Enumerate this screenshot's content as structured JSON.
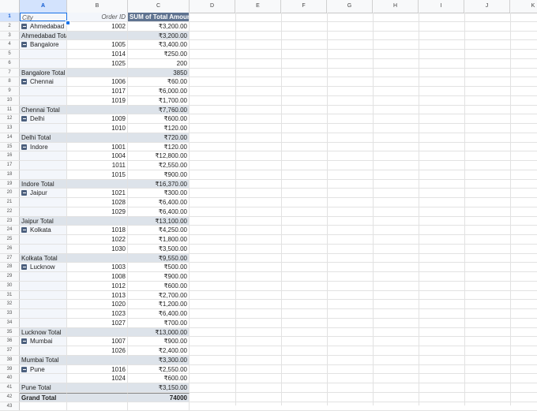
{
  "columns": [
    "A",
    "B",
    "C",
    "D",
    "E",
    "F",
    "G",
    "H",
    "I",
    "J",
    "K"
  ],
  "header": {
    "city": "City",
    "order_id": "Order ID",
    "sum": "SUM of Total Amount"
  },
  "rows": [
    {
      "type": "data",
      "city": "Ahmedabad",
      "order": "1002",
      "amount": "₹3,200.00",
      "icon": true
    },
    {
      "type": "total",
      "city": "Ahmedabad Total",
      "order": "",
      "amount": "₹3,200.00"
    },
    {
      "type": "data",
      "city": "Bangalore",
      "order": "1005",
      "amount": "₹3,400.00",
      "icon": true
    },
    {
      "type": "data",
      "city": "",
      "order": "1014",
      "amount": "₹250.00"
    },
    {
      "type": "data",
      "city": "",
      "order": "1025",
      "amount": "200"
    },
    {
      "type": "total",
      "city": "Bangalore Total",
      "order": "",
      "amount": "3850"
    },
    {
      "type": "data",
      "city": "Chennai",
      "order": "1006",
      "amount": "₹60.00",
      "icon": true
    },
    {
      "type": "data",
      "city": "",
      "order": "1017",
      "amount": "₹6,000.00"
    },
    {
      "type": "data",
      "city": "",
      "order": "1019",
      "amount": "₹1,700.00"
    },
    {
      "type": "total",
      "city": "Chennai Total",
      "order": "",
      "amount": "₹7,760.00"
    },
    {
      "type": "data",
      "city": "Delhi",
      "order": "1009",
      "amount": "₹600.00",
      "icon": true
    },
    {
      "type": "data",
      "city": "",
      "order": "1010",
      "amount": "₹120.00"
    },
    {
      "type": "total",
      "city": "Delhi Total",
      "order": "",
      "amount": "₹720.00"
    },
    {
      "type": "data",
      "city": "Indore",
      "order": "1001",
      "amount": "₹120.00",
      "icon": true
    },
    {
      "type": "data",
      "city": "",
      "order": "1004",
      "amount": "₹12,800.00"
    },
    {
      "type": "data",
      "city": "",
      "order": "1011",
      "amount": "₹2,550.00"
    },
    {
      "type": "data",
      "city": "",
      "order": "1015",
      "amount": "₹900.00"
    },
    {
      "type": "total",
      "city": "Indore Total",
      "order": "",
      "amount": "₹16,370.00"
    },
    {
      "type": "data",
      "city": "Jaipur",
      "order": "1021",
      "amount": "₹300.00",
      "icon": true
    },
    {
      "type": "data",
      "city": "",
      "order": "1028",
      "amount": "₹6,400.00"
    },
    {
      "type": "data",
      "city": "",
      "order": "1029",
      "amount": "₹6,400.00"
    },
    {
      "type": "total",
      "city": "Jaipur Total",
      "order": "",
      "amount": "₹13,100.00"
    },
    {
      "type": "data",
      "city": "Kolkata",
      "order": "1018",
      "amount": "₹4,250.00",
      "icon": true
    },
    {
      "type": "data",
      "city": "",
      "order": "1022",
      "amount": "₹1,800.00"
    },
    {
      "type": "data",
      "city": "",
      "order": "1030",
      "amount": "₹3,500.00"
    },
    {
      "type": "total",
      "city": "Kolkata Total",
      "order": "",
      "amount": "₹9,550.00"
    },
    {
      "type": "data",
      "city": "Lucknow",
      "order": "1003",
      "amount": "₹500.00",
      "icon": true
    },
    {
      "type": "data",
      "city": "",
      "order": "1008",
      "amount": "₹900.00"
    },
    {
      "type": "data",
      "city": "",
      "order": "1012",
      "amount": "₹600.00"
    },
    {
      "type": "data",
      "city": "",
      "order": "1013",
      "amount": "₹2,700.00"
    },
    {
      "type": "data",
      "city": "",
      "order": "1020",
      "amount": "₹1,200.00"
    },
    {
      "type": "data",
      "city": "",
      "order": "1023",
      "amount": "₹6,400.00"
    },
    {
      "type": "data",
      "city": "",
      "order": "1027",
      "amount": "₹700.00"
    },
    {
      "type": "total",
      "city": "Lucknow Total",
      "order": "",
      "amount": "₹13,000.00"
    },
    {
      "type": "data",
      "city": "Mumbai",
      "order": "1007",
      "amount": "₹900.00",
      "icon": true
    },
    {
      "type": "data",
      "city": "",
      "order": "1026",
      "amount": "₹2,400.00"
    },
    {
      "type": "total",
      "city": "Mumbai Total",
      "order": "",
      "amount": "₹3,300.00"
    },
    {
      "type": "data",
      "city": "Pune",
      "order": "1016",
      "amount": "₹2,550.00",
      "icon": true
    },
    {
      "type": "data",
      "city": "",
      "order": "1024",
      "amount": "₹600.00"
    },
    {
      "type": "total",
      "city": "Pune Total",
      "order": "",
      "amount": "₹3,150.00"
    },
    {
      "type": "grand",
      "city": "Grand Total",
      "order": "",
      "amount": "74000"
    },
    {
      "type": "blank",
      "city": "",
      "order": "",
      "amount": ""
    }
  ]
}
